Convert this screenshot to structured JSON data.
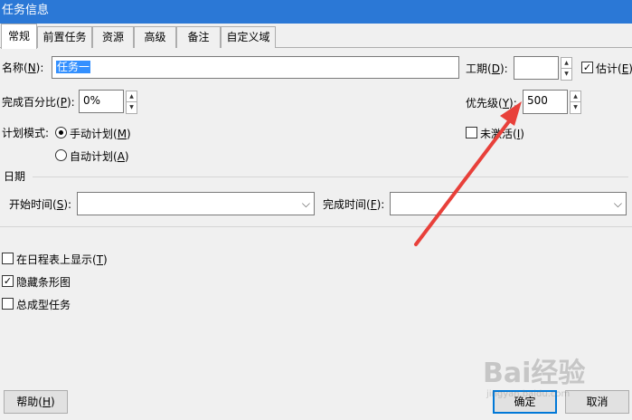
{
  "window": {
    "title": "任务信息"
  },
  "tabs": [
    {
      "label": "常规",
      "active": true
    },
    {
      "label": "前置任务",
      "active": false
    },
    {
      "label": "资源",
      "active": false
    },
    {
      "label": "高级",
      "active": false
    },
    {
      "label": "备注",
      "active": false
    },
    {
      "label": "自定义域",
      "active": false
    }
  ],
  "general": {
    "name_label": "名称(",
    "name_key": "N",
    "name_label_end": "):",
    "name_value": "任务一",
    "duration_label": "工期(",
    "duration_key": "D",
    "duration_label_end": "):",
    "duration_value": "",
    "estimated_label": "估计(",
    "estimated_key": "E",
    "estimated_label_end": ")",
    "estimated_checked": true,
    "percent_label": "完成百分比(",
    "percent_key": "P",
    "percent_label_end": "):",
    "percent_value": "0%",
    "priority_label": "优先级(",
    "priority_key": "Y",
    "priority_label_end": "):",
    "priority_value": "500",
    "schedule_mode_label": "计划模式:",
    "manual_label": "手动计划(",
    "manual_key": "M",
    "manual_label_end": ")",
    "auto_label": "自动计划(",
    "auto_key": "A",
    "auto_label_end": ")",
    "inactive_label": "未激活(",
    "inactive_key": "I",
    "inactive_label_end": ")",
    "dates_header": "日期",
    "start_label": "开始时间(",
    "start_key": "S",
    "start_label_end": "):",
    "start_value": "",
    "finish_label": "完成时间(",
    "finish_key": "F",
    "finish_label_end": "):",
    "finish_value": "",
    "timeline_label": "在日程表上显示(",
    "timeline_key": "T",
    "timeline_label_end": ")",
    "hide_bar_label": "隐藏条形图",
    "summary_label": "总成型任务"
  },
  "buttons": {
    "help_label": "帮助(",
    "help_key": "H",
    "help_label_end": ")",
    "ok_label": "确定",
    "cancel_label": "取消"
  },
  "watermark": {
    "text": "Bai经验",
    "sub": "jingyan.baidu.com"
  },
  "colors": {
    "titlebar": "#2b78d6",
    "annotation_arrow": "#e8403a",
    "selection": "#3390ff"
  }
}
